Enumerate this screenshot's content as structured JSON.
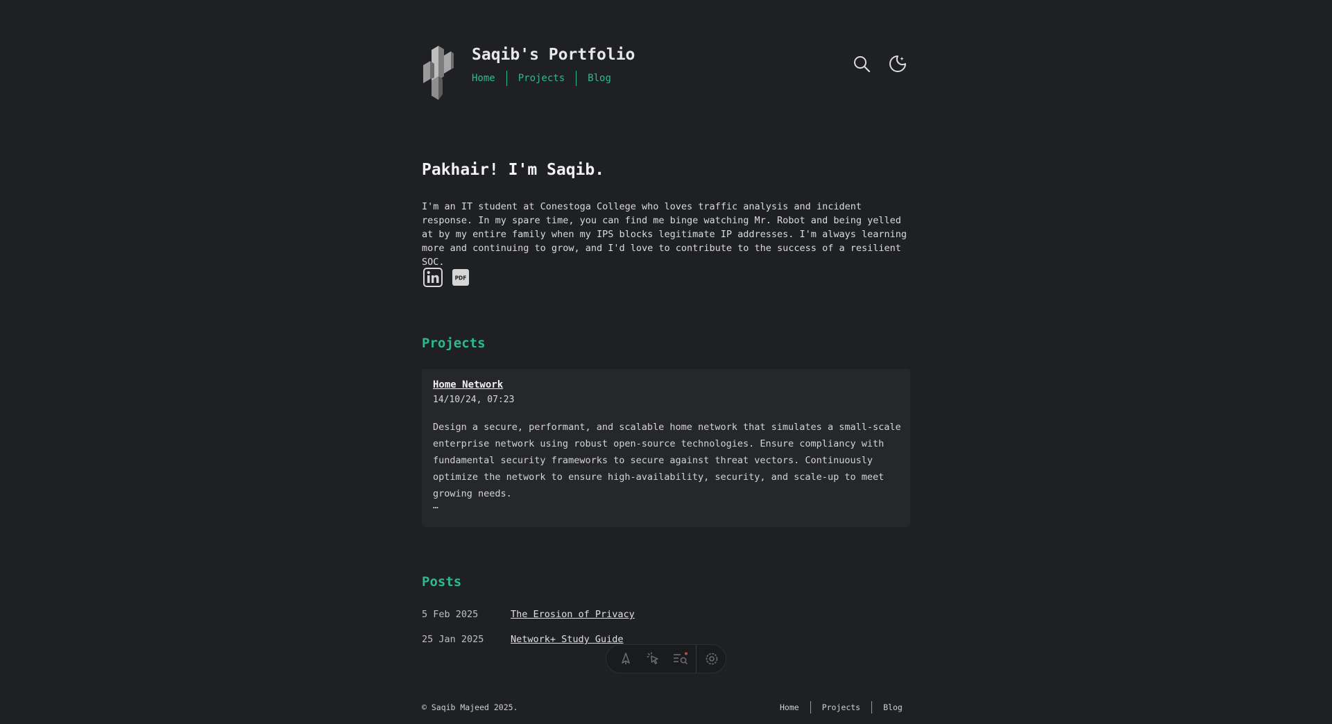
{
  "header": {
    "site_title": "Saqib's Portfolio",
    "nav": [
      "Home",
      "Projects",
      "Blog"
    ]
  },
  "hero": {
    "title": "Pakhair! I'm Saqib.",
    "bio": "I'm an IT student at Conestoga College who loves traffic analysis and incident response. In my spare time, you can find me binge watching Mr. Robot and being yelled at by my entire family when my IPS blocks legitimate IP addresses. I'm always learning more and continuing to grow, and I'd love to contribute to the success of a resilient SOC.",
    "pdf_label": "PDF"
  },
  "projects": {
    "heading": "Projects",
    "items": [
      {
        "title": "Home Network",
        "date": "14/10/24, 07:23",
        "description": "Design a secure, performant, and scalable home network that simulates a small-scale enterprise network using robust open-source technologies. Ensure compliancy with fundamental security frameworks to secure against threat vectors. Continuously optimize the network to ensure high-availability, security, and scale-up to meet growing needs.",
        "more": "…"
      }
    ]
  },
  "posts": {
    "heading": "Posts",
    "items": [
      {
        "date": "5 Feb 2025",
        "title": "The Erosion of Privacy"
      },
      {
        "date": "25 Jan 2025",
        "title": "Network+ Study Guide"
      }
    ]
  },
  "footer": {
    "copyright": "© Saqib Majeed 2025.",
    "nav": [
      "Home",
      "Projects",
      "Blog"
    ]
  },
  "colors": {
    "accent": "#2bbc8a",
    "background": "#1f2023",
    "card": "#26272b"
  }
}
